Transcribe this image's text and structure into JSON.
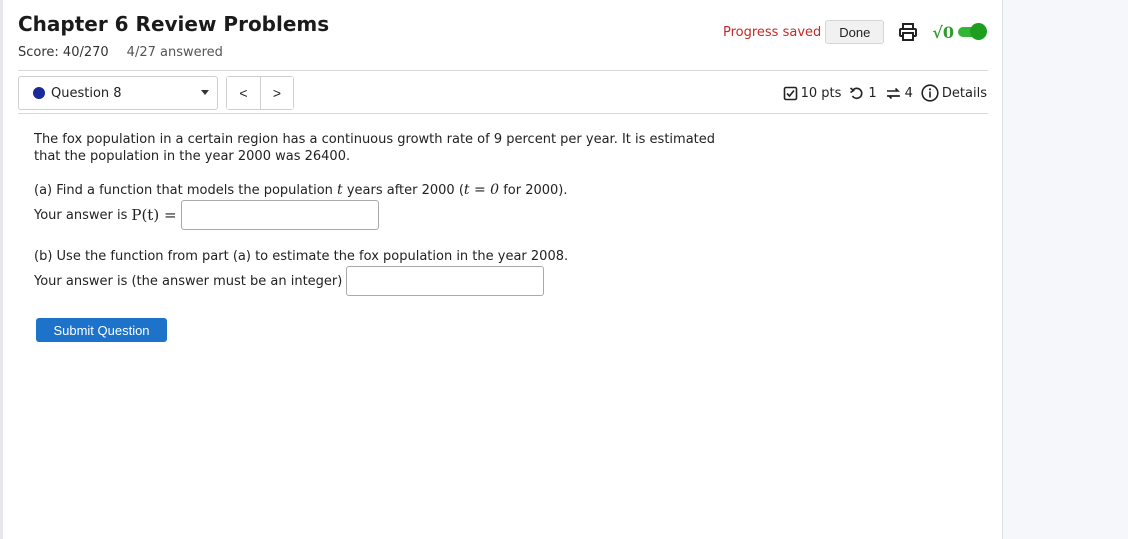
{
  "header": {
    "title": "Chapter 6 Review Problems",
    "score": "Score: 40/270",
    "answered": "4/27 answered",
    "progress_saved": "Progress saved",
    "done_label": "Done",
    "mathjax_symbol": "√0"
  },
  "question_bar": {
    "selected_question": "Question 8",
    "prev": "<",
    "next": ">",
    "points": "10 pts",
    "tries": "1",
    "versions": "4",
    "details_label": "Details"
  },
  "question": {
    "intro": "The fox population in a certain region has a continuous growth rate of 9 percent per year. It is estimated that the population in the year 2000 was 26400.",
    "part_a_prefix": "(a) Find a function that models the population ",
    "part_a_var": "t",
    "part_a_middle": " years after 2000 (",
    "part_a_eq": "t = 0",
    "part_a_suffix": " for 2000).",
    "answer_a_label": "Your answer is ",
    "answer_a_math": "P(t) =",
    "answer_a_value": "",
    "part_b": "(b) Use the function from part (a) to estimate the fox population in the year 2008.",
    "answer_b_label": "Your answer is (the answer must be an integer)",
    "answer_b_value": ""
  },
  "submit_label": "Submit Question",
  "colors": {
    "accent": "#1c73c9",
    "progress_saved": "#c62828",
    "toggle_on": "#35b535",
    "question_dot": "#1a2a9c"
  }
}
